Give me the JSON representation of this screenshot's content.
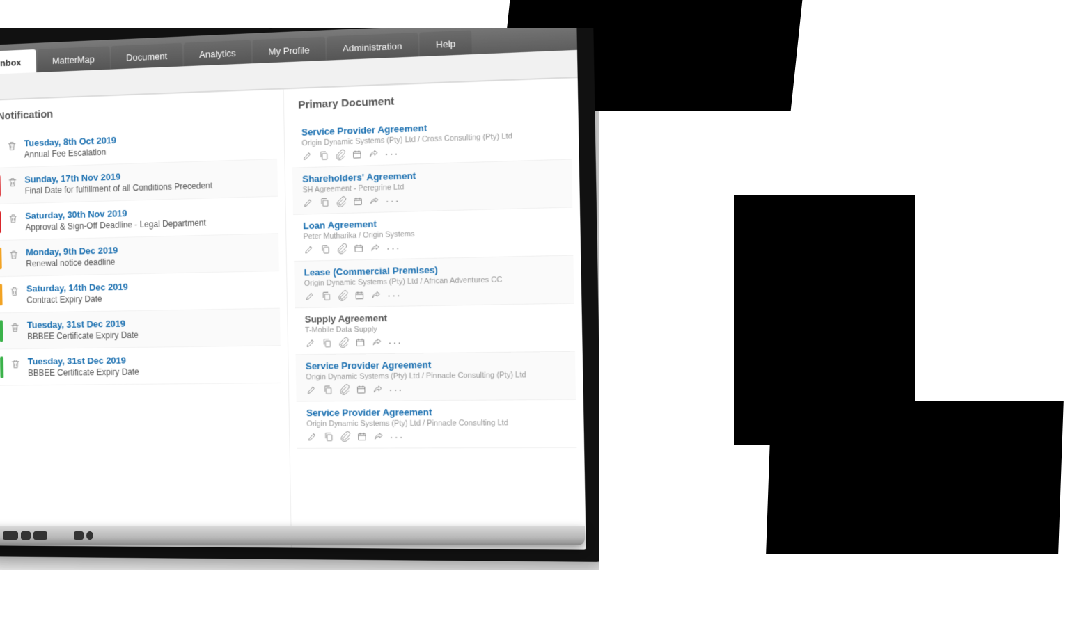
{
  "nav": {
    "tabs": [
      "Inbox",
      "MatterMap",
      "Document",
      "Analytics",
      "My Profile",
      "Administration",
      "Help"
    ],
    "active": "Inbox",
    "breadcrumb": "x"
  },
  "columns": {
    "notification_header": "Notification",
    "document_header": "Primary Document"
  },
  "notifications": [
    {
      "color": "none",
      "date": "Tuesday, 8th Oct 2019",
      "desc": "Annual Fee Escalation"
    },
    {
      "color": "red",
      "date": "Sunday, 17th Nov 2019",
      "desc": "Final Date for fulfillment of all Conditions Precedent"
    },
    {
      "color": "red",
      "date": "Saturday, 30th Nov 2019",
      "desc": "Approval & Sign-Off Deadline - Legal Department"
    },
    {
      "color": "orange",
      "date": "Monday, 9th Dec 2019",
      "desc": "Renewal notice deadline"
    },
    {
      "color": "orange",
      "date": "Saturday, 14th Dec 2019",
      "desc": "Contract Expiry Date"
    },
    {
      "color": "green",
      "date": "Tuesday, 31st Dec 2019",
      "desc": "BBBEE Certificate Expiry Date"
    },
    {
      "color": "green",
      "date": "Tuesday, 31st Dec 2019",
      "desc": "BBBEE Certificate Expiry Date"
    }
  ],
  "documents": [
    {
      "title": "Service Provider Agreement",
      "muted": false,
      "sub": "Origin Dynamic Systems (Pty) Ltd / Cross Consulting (Pty) Ltd"
    },
    {
      "title": "Shareholders' Agreement",
      "muted": false,
      "sub": "SH Agreement - Peregrine Ltd"
    },
    {
      "title": "Loan Agreement",
      "muted": false,
      "sub": "Peter Mutharika / Origin Systems"
    },
    {
      "title": "Lease (Commercial Premises)",
      "muted": false,
      "sub": "Origin Dynamic Systems (Pty) Ltd / African Adventures CC"
    },
    {
      "title": "Supply Agreement",
      "muted": true,
      "sub": "T-Mobile Data Supply"
    },
    {
      "title": "Service Provider Agreement",
      "muted": false,
      "sub": "Origin Dynamic Systems (Pty) Ltd / Pinnacle Consulting (Pty) Ltd"
    },
    {
      "title": "Service Provider Agreement",
      "muted": false,
      "sub": "Origin Dynamic Systems (Pty) Ltd / Pinnacle Consulting Ltd"
    }
  ]
}
